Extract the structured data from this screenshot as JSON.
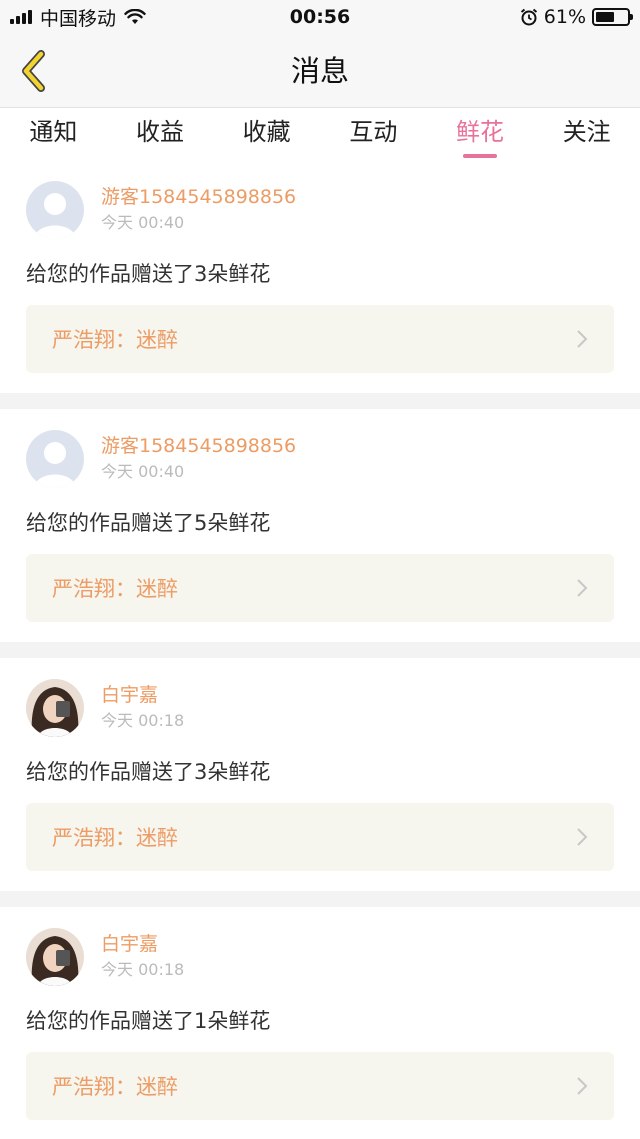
{
  "status_bar": {
    "carrier": "中国移动",
    "time": "00:56",
    "battery": "61%",
    "battery_level": 0.61
  },
  "nav": {
    "title": "消息"
  },
  "tabs": [
    {
      "label": "通知",
      "active": false
    },
    {
      "label": "收益",
      "active": false
    },
    {
      "label": "收藏",
      "active": false
    },
    {
      "label": "互动",
      "active": false
    },
    {
      "label": "鲜花",
      "active": true
    },
    {
      "label": "关注",
      "active": false
    }
  ],
  "messages": [
    {
      "user": "游客1584545898856",
      "time": "今天 00:40",
      "text": "给您的作品赠送了3朵鲜花",
      "work": "严浩翔：迷醉",
      "avatar": "default-avatar"
    },
    {
      "user": "游客1584545898856",
      "time": "今天 00:40",
      "text": "给您的作品赠送了5朵鲜花",
      "work": "严浩翔：迷醉",
      "avatar": "default-avatar"
    },
    {
      "user": "白宇嘉",
      "time": "今天 00:18",
      "text": "给您的作品赠送了3朵鲜花",
      "work": "严浩翔：迷醉",
      "avatar": "photo-avatar"
    },
    {
      "user": "白宇嘉",
      "time": "今天 00:18",
      "text": "给您的作品赠送了1朵鲜花",
      "work": "严浩翔：迷醉",
      "avatar": "photo-avatar"
    }
  ],
  "colors": {
    "accent_pink": "#e8739a",
    "username_orange": "#ec9c64",
    "back_arrow_yellow": "#f2d431"
  }
}
